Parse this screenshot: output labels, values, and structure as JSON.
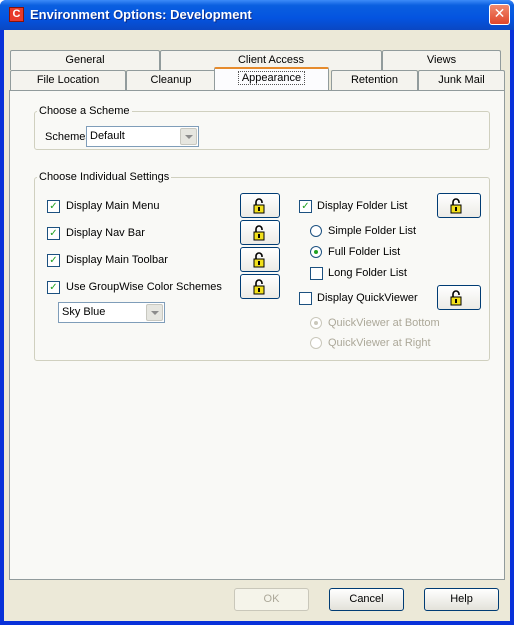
{
  "window": {
    "title": "Environment Options:  Development",
    "app_icon_letter": "C",
    "close_glyph": "✕"
  },
  "tabs": {
    "row1": [
      {
        "label": "General"
      },
      {
        "label": "Client Access"
      },
      {
        "label": "Views"
      }
    ],
    "row2": [
      {
        "label": "File Location"
      },
      {
        "label": "Cleanup"
      },
      {
        "label": "Appearance",
        "active": true
      },
      {
        "label": "Retention"
      },
      {
        "label": "Junk Mail"
      }
    ]
  },
  "scheme_group": {
    "legend": "Choose a Scheme",
    "label": "Schemes:",
    "value": "Default"
  },
  "settings_group": {
    "legend": "Choose Individual Settings",
    "left": [
      {
        "label": "Display Main Menu",
        "checked": true
      },
      {
        "label": "Display Nav Bar",
        "checked": true
      },
      {
        "label": "Display Main Toolbar",
        "checked": true
      },
      {
        "label": "Use GroupWise Color Schemes",
        "checked": true
      }
    ],
    "color_scheme_value": "Sky Blue",
    "folder_list": {
      "label": "Display Folder List",
      "checked": true
    },
    "folder_options": [
      {
        "label": "Simple Folder List",
        "selected": false
      },
      {
        "label": "Full Folder List",
        "selected": true
      }
    ],
    "long_folder_list": {
      "label": "Long Folder List",
      "checked": false
    },
    "quickviewer": {
      "label": "Display QuickViewer",
      "checked": false
    },
    "quickviewer_options": [
      {
        "label": "QuickViewer at Bottom",
        "selected": true,
        "disabled": true
      },
      {
        "label": "QuickViewer at Right",
        "selected": false,
        "disabled": true
      }
    ]
  },
  "buttons": {
    "ok": "OK",
    "cancel": "Cancel",
    "help": "Help"
  },
  "colors": {
    "title_bar": "#0454e0",
    "dialog_bg": "#ece9d8",
    "active_tab_accent": "#e68b2c",
    "lock_yellow": "#f2e01c"
  }
}
